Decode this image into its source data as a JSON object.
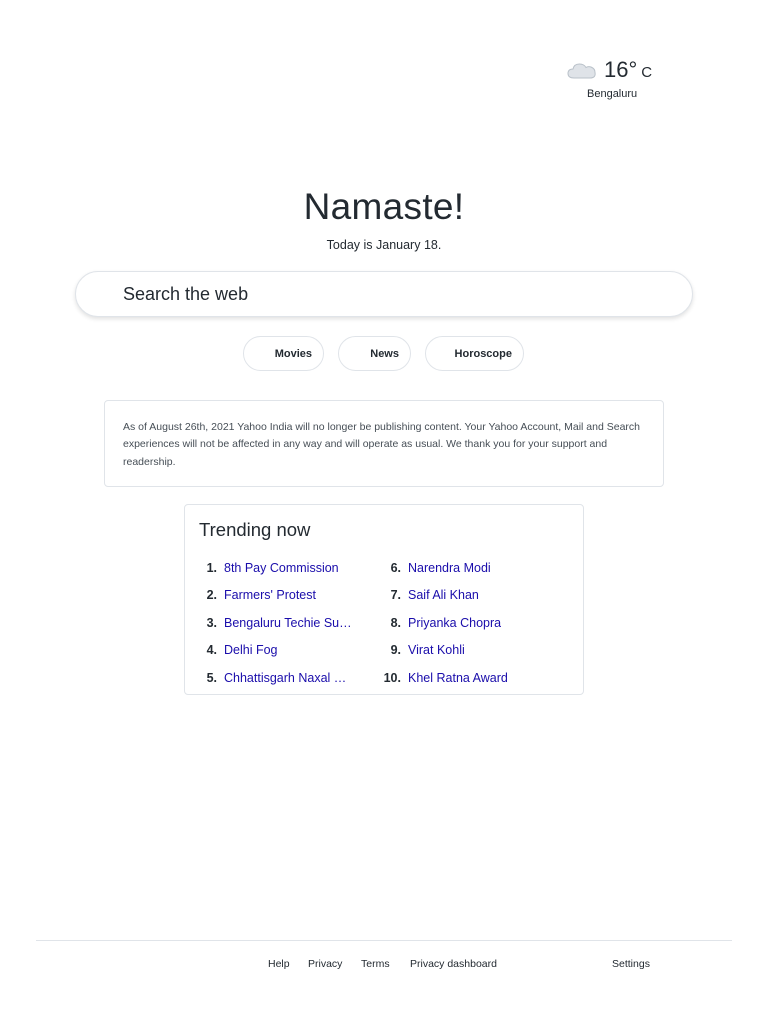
{
  "weather": {
    "icon": "cloud-icon",
    "temperature": "16°",
    "unit": "C",
    "city": "Bengaluru"
  },
  "greeting": "Namaste!",
  "date_line": "Today is January 18.",
  "search": {
    "placeholder": "Search the web",
    "value": ""
  },
  "quick_links": [
    "Movies",
    "News",
    "Horoscope"
  ],
  "notice": "As of August 26th, 2021 Yahoo India will no longer be publishing content. Your Yahoo Account, Mail and Search experiences will not be affected in any way and will operate as usual. We thank you for your support and readership.",
  "trending": {
    "title": "Trending now",
    "items": [
      {
        "rank": "1.",
        "label": "8th Pay Commission"
      },
      {
        "rank": "2.",
        "label": "Farmers' Protest"
      },
      {
        "rank": "3.",
        "label": "Bengaluru Techie Suicide"
      },
      {
        "rank": "4.",
        "label": "Delhi Fog"
      },
      {
        "rank": "5.",
        "label": "Chhattisgarh Naxal Encounter"
      },
      {
        "rank": "6.",
        "label": "Narendra Modi"
      },
      {
        "rank": "7.",
        "label": "Saif Ali Khan"
      },
      {
        "rank": "8.",
        "label": "Priyanka Chopra"
      },
      {
        "rank": "9.",
        "label": "Virat Kohli"
      },
      {
        "rank": "10.",
        "label": "Khel Ratna Award"
      }
    ]
  },
  "footer": {
    "help": "Help",
    "privacy": "Privacy",
    "terms": "Terms",
    "privacy_dashboard": "Privacy dashboard",
    "settings": "Settings"
  },
  "colors": {
    "link": "#1a0dab",
    "text": "#232a31",
    "border": "#e0e4e9"
  }
}
